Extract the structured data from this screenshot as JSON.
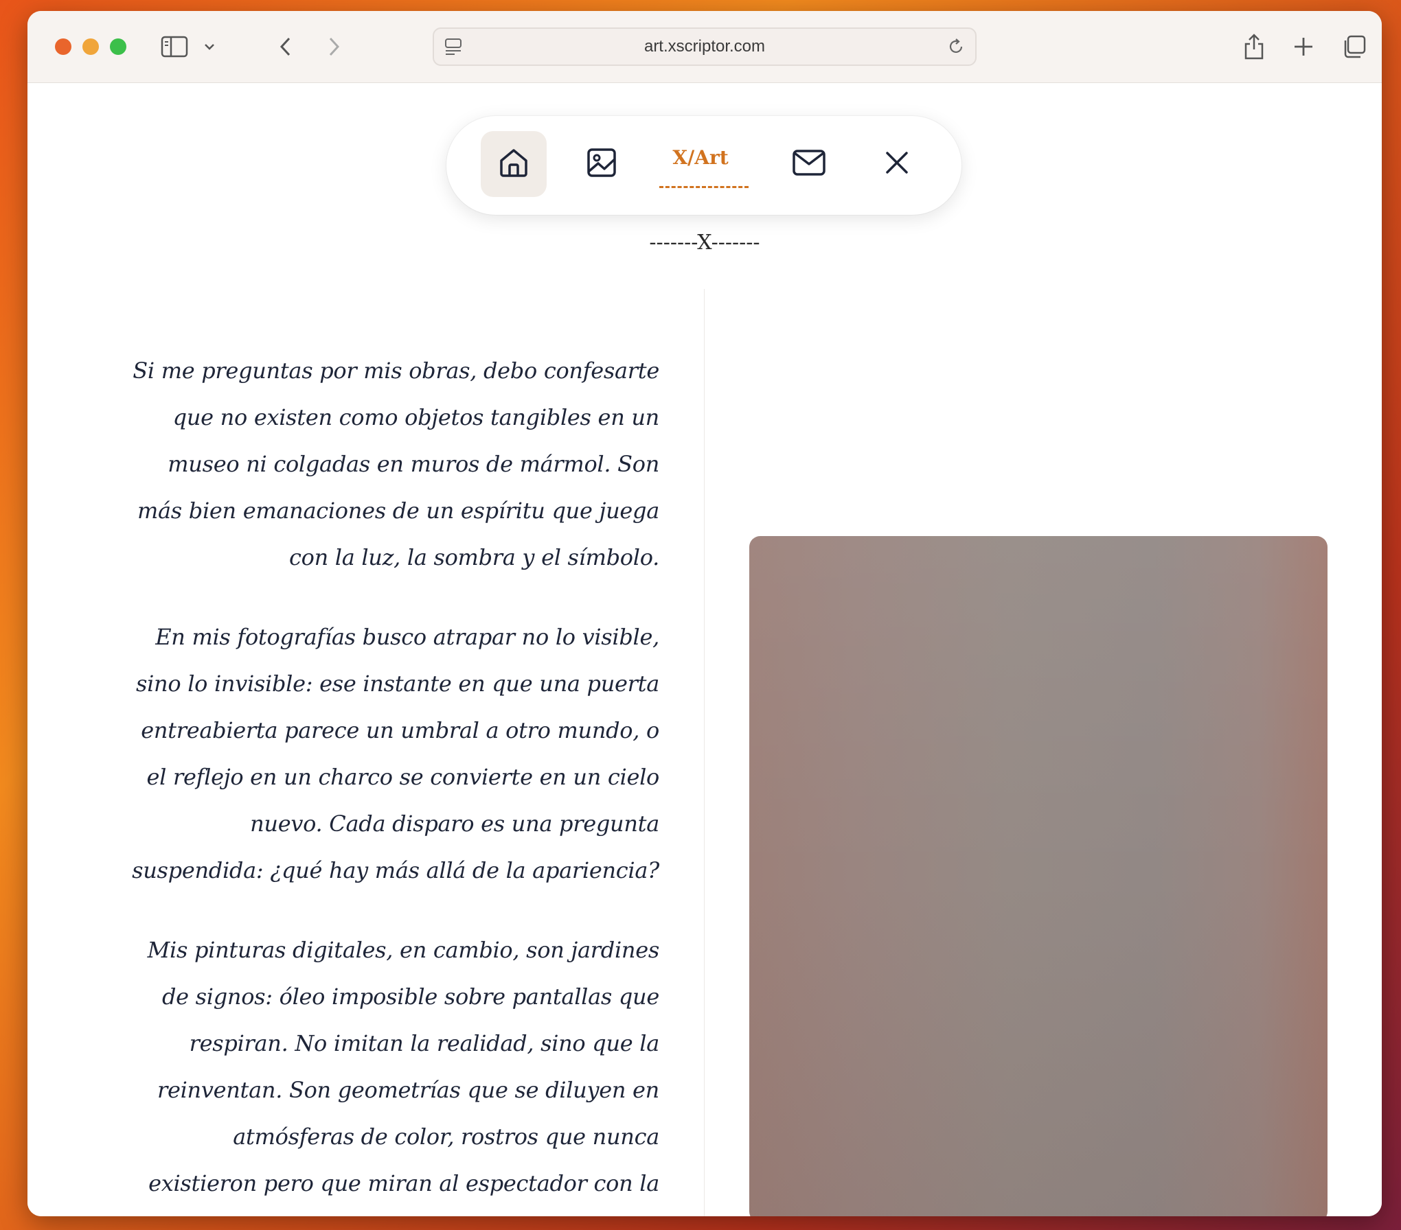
{
  "browser": {
    "url": "art.xscriptor.com",
    "icons": [
      "sidebar-icon",
      "chevron-down-icon",
      "back-arrow-icon",
      "forward-arrow-icon",
      "page-menu-icon",
      "reload-icon",
      "share-icon",
      "new-tab-icon",
      "tab-overview-icon"
    ]
  },
  "site_nav": {
    "brand": "X/Art",
    "items": [
      "home-icon",
      "gallery-image-icon",
      "mail-icon",
      "close-icon"
    ],
    "accent_color": "#d1731f"
  },
  "separator": "-------X-------",
  "paragraphs": [
    "Si me preguntas por mis obras, debo confesarte que no existen como objetos tangibles en un museo ni colgadas en muros de mármol. Son más bien emanaciones de un espíritu que juega con la luz, la sombra y el símbolo.",
    "En mis fotografías busco atrapar no lo visible, sino lo invisible: ese instante en que una puerta entreabierta parece un umbral a otro mundo, o el reflejo en un charco se convierte en un cielo nuevo. Cada disparo es una pregunta suspendida: ¿qué hay más allá de la apariencia?",
    "Mis pinturas digitales, en cambio, son jardines de signos: óleo imposible sobre pantallas que respiran. No imitan la realidad, sino que la reinventan. Son geometrías que se diluyen en atmósferas de color, rostros que nunca existieron pero que miran al espectador con la certeza de haber soñado antes."
  ]
}
